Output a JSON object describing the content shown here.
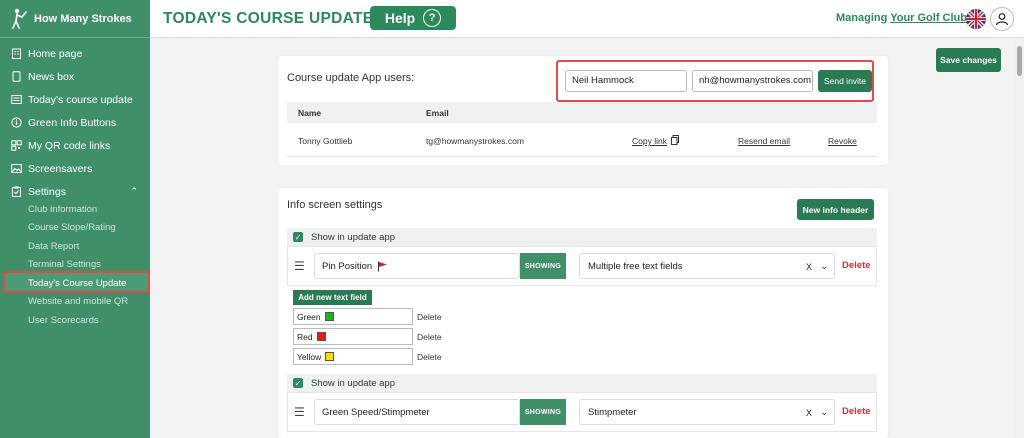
{
  "brand": {
    "name": "How Many Strokes"
  },
  "sidebar": {
    "items": [
      {
        "label": "Home page",
        "icon": "building-icon"
      },
      {
        "label": "News box",
        "icon": "tablet-icon"
      },
      {
        "label": "Today's course update",
        "icon": "list-icon"
      },
      {
        "label": "Green Info Buttons",
        "icon": "info-circle-icon"
      },
      {
        "label": "My QR code links",
        "icon": "qr-code-icon"
      },
      {
        "label": "Screensavers",
        "icon": "image-icon"
      },
      {
        "label": "Settings",
        "icon": "clipboard-icon"
      }
    ],
    "settings_sub": [
      "Club information",
      "Course Slope/Rating",
      "Data Report",
      "Terminal Settings",
      "Today's Course Update",
      "Website and mobile QR",
      "User Scorecards"
    ]
  },
  "header": {
    "title": "TODAY'S COURSE UPDATE",
    "help_label": "Help",
    "help_glyph": "?",
    "managing_prefix": "Managing",
    "managing_club": "Your Golf Club"
  },
  "save_label": "Save changes",
  "app_users": {
    "title": "Course update App users:",
    "name_value": "Neil Hammock",
    "email_value": "nh@howmanystrokes.com",
    "send_label": "Send invite",
    "columns": {
      "name": "Name",
      "email": "Email"
    },
    "rows": [
      {
        "name": "Tonny Gottlieb",
        "email": "tg@howmanystrokes.com",
        "copy": "Copy link",
        "resend": "Resend email",
        "revoke": "Revoke"
      }
    ]
  },
  "info": {
    "title": "Info screen settings",
    "new_header_label": "New info header",
    "show_label": "Show in update app",
    "showing_label": "SHOWING",
    "delete_label": "Delete",
    "clear_glyph": "X",
    "add_text_label": "Add new text field",
    "rows": [
      {
        "name": "Pin Position",
        "type": "Multiple free text fields"
      },
      {
        "name": "Green Speed/Stimpmeter",
        "type": "Stimpmeter"
      }
    ],
    "options": [
      {
        "label": "Green",
        "color": "#22b022"
      },
      {
        "label": "Red",
        "color": "#d82020"
      },
      {
        "label": "Yellow",
        "color": "#f2e000"
      }
    ]
  },
  "colors": {
    "brand_green": "#3f8f68",
    "accent_green": "#2a8a5c",
    "alert_red": "#e14a4a"
  }
}
